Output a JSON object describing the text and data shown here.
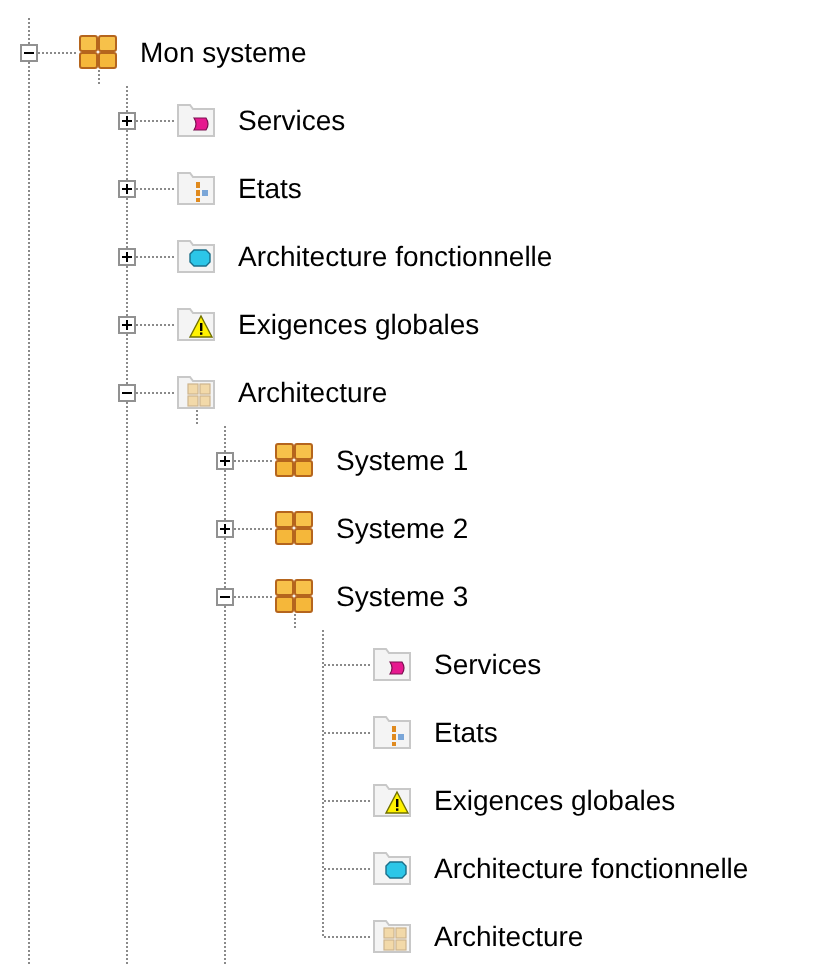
{
  "root": {
    "label": "Mon systeme",
    "kind": "system",
    "expanded": true,
    "children": [
      {
        "label": "Services",
        "kind": "services",
        "expanded": false
      },
      {
        "label": "Etats",
        "kind": "states",
        "expanded": false
      },
      {
        "label": "Architecture fonctionnelle",
        "kind": "functional",
        "expanded": false
      },
      {
        "label": "Exigences globales",
        "kind": "requirements",
        "expanded": false
      },
      {
        "label": "Architecture",
        "kind": "architecture",
        "expanded": true,
        "children": [
          {
            "label": "Systeme 1",
            "kind": "system",
            "expanded": false
          },
          {
            "label": "Systeme 2",
            "kind": "system",
            "expanded": false
          },
          {
            "label": "Systeme 3",
            "kind": "system",
            "expanded": true,
            "children": [
              {
                "label": "Services",
                "kind": "services"
              },
              {
                "label": "Etats",
                "kind": "states"
              },
              {
                "label": "Exigences globales",
                "kind": "requirements"
              },
              {
                "label": "Architecture fonctionnelle",
                "kind": "functional"
              },
              {
                "label": "Architecture",
                "kind": "architecture"
              }
            ]
          }
        ]
      }
    ]
  }
}
